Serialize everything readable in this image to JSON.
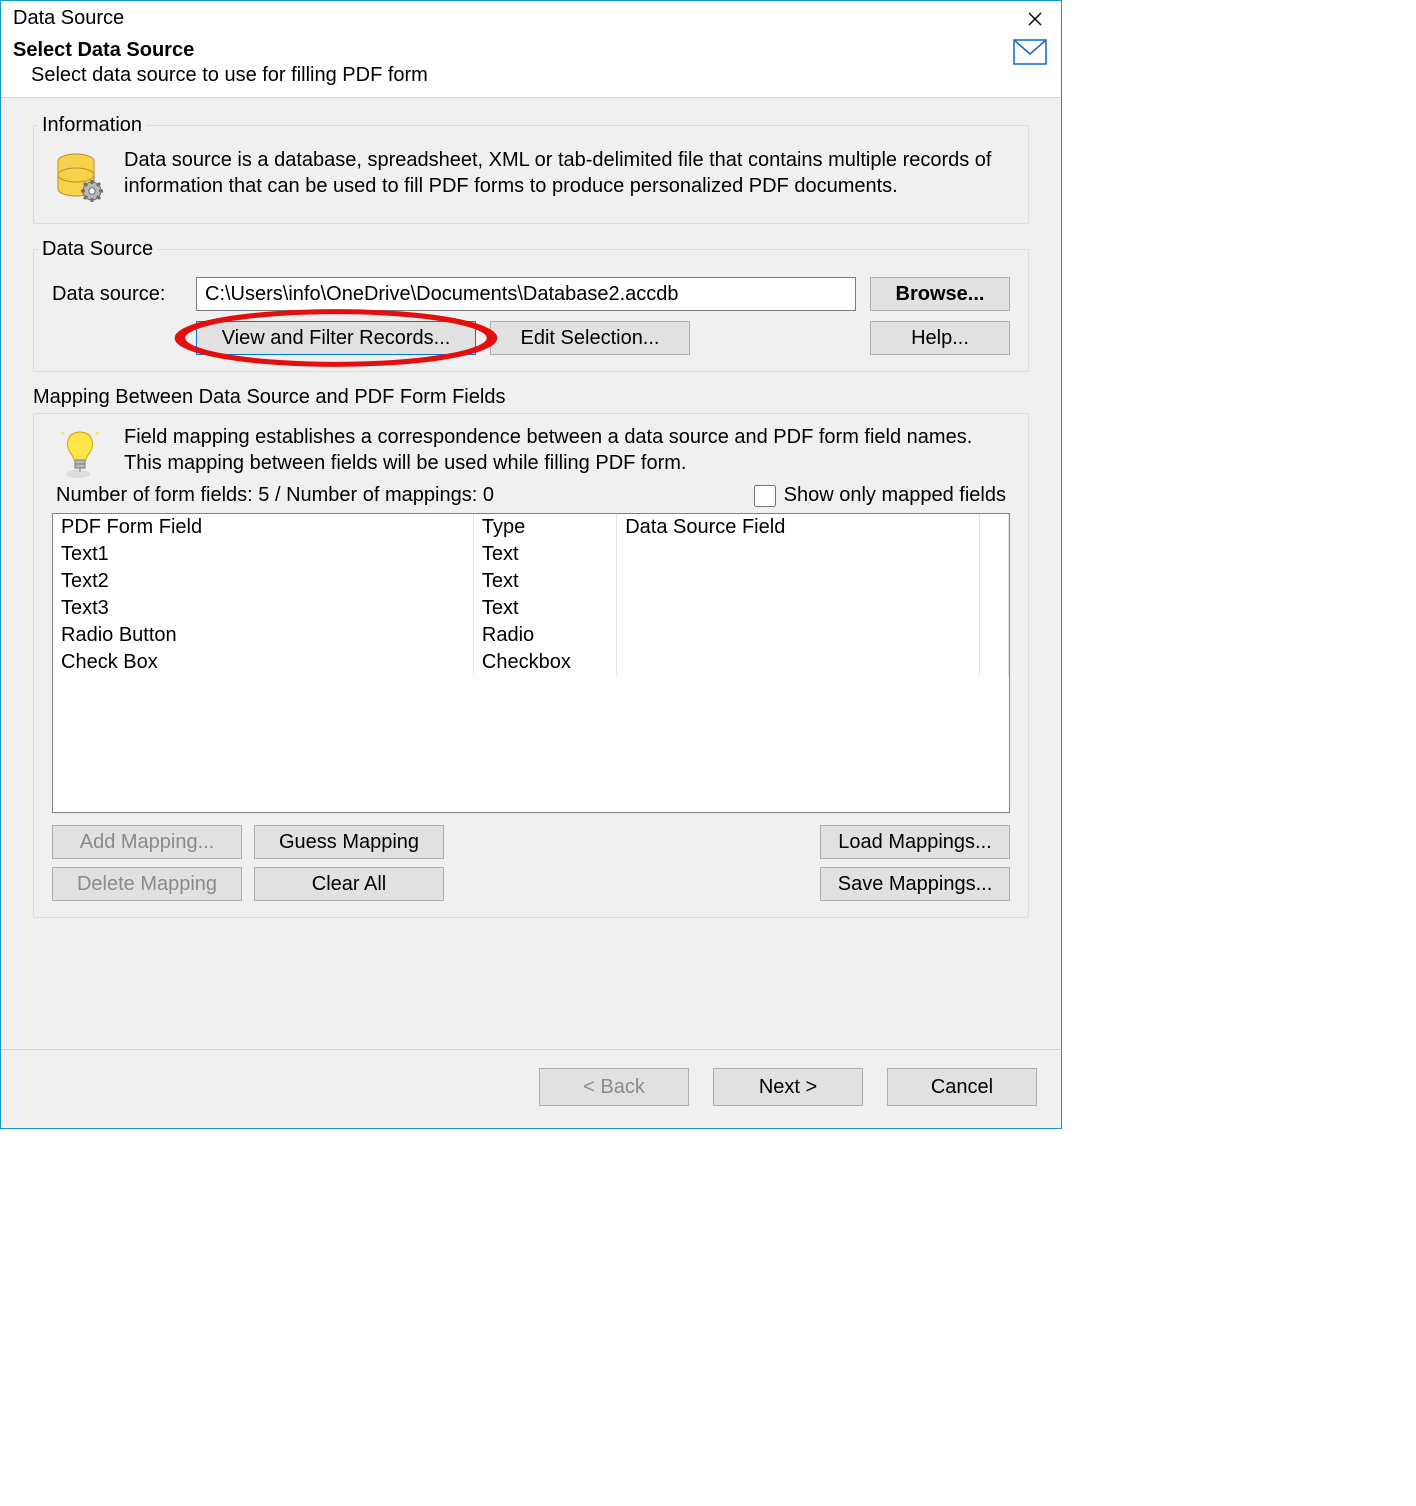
{
  "window": {
    "title": "Data Source"
  },
  "header": {
    "heading": "Select Data Source",
    "sub": "Select data source to use for filling PDF form"
  },
  "sections": {
    "information": {
      "legend": "Information",
      "text": "Data source is a database, spreadsheet, XML or tab-delimited file that contains multiple records of information that can be used to fill PDF forms to produce personalized PDF documents."
    },
    "dataSource": {
      "legend": "Data Source",
      "label": "Data source:",
      "path": "C:\\Users\\info\\OneDrive\\Documents\\Database2.accdb",
      "browse": "Browse...",
      "viewFilter": "View and Filter Records...",
      "editSelection": "Edit Selection...",
      "help": "Help..."
    },
    "mapping": {
      "legend": "Mapping Between Data Source and PDF Form Fields",
      "intro": "Field mapping establishes a correspondence between a data source and PDF form field names. This mapping between fields will be used while filling PDF form.",
      "counts": "Number of form fields: 5 / Number of mappings: 0",
      "showOnlyMapped": "Show only mapped fields",
      "columns": {
        "c1": "PDF Form Field",
        "c2": "Type",
        "c3": "Data Source Field"
      },
      "rows": [
        {
          "field": "Text1",
          "type": "Text",
          "map": ""
        },
        {
          "field": "Text2",
          "type": "Text",
          "map": ""
        },
        {
          "field": "Text3",
          "type": "Text",
          "map": ""
        },
        {
          "field": "Radio Button",
          "type": "Radio",
          "map": ""
        },
        {
          "field": "Check Box",
          "type": "Checkbox",
          "map": ""
        }
      ],
      "buttons": {
        "addMapping": "Add Mapping...",
        "guessMapping": "Guess Mapping",
        "loadMappings": "Load Mappings...",
        "deleteMapping": "Delete Mapping",
        "clearAll": "Clear All",
        "saveMappings": "Save Mappings..."
      }
    }
  },
  "footer": {
    "back": "< Back",
    "next": "Next >",
    "cancel": "Cancel"
  }
}
